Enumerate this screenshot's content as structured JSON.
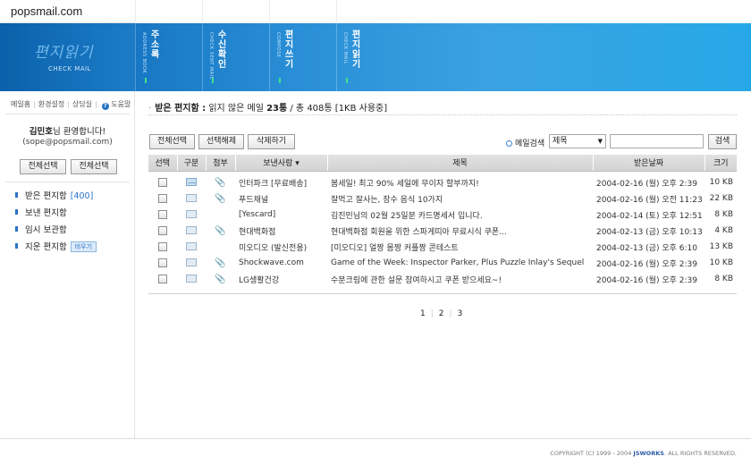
{
  "site": {
    "logo": "popsmail.com"
  },
  "banner": {
    "title": "편지읽기",
    "subtitle": "CHECK MAIL",
    "tabs": [
      {
        "ko": "주소록",
        "en": "ADDRESS BOOK"
      },
      {
        "ko": "수신확인",
        "en": "CHECK SENT MAIL"
      },
      {
        "ko": "편지쓰기",
        "en": "COMPOSE"
      },
      {
        "ko": "편지읽기",
        "en": "CHECK MAIL"
      }
    ]
  },
  "sidebar": {
    "links": [
      "메일홈",
      "환경설정",
      "상담실",
      "도움말"
    ],
    "welcome_name": "김민호",
    "welcome_suffix": "님 환영합니다!",
    "email": "(sope@popsmail.com)",
    "btn_a": "전체선택",
    "btn_b": "전체선택",
    "folders": [
      {
        "name": "받은 편지함",
        "count": "[400]"
      },
      {
        "name": "보낸 편지함"
      },
      {
        "name": "임시 보관함"
      },
      {
        "name": "지운 편지함",
        "action": "비우기"
      }
    ]
  },
  "main": {
    "title_prefix": "·",
    "title": "받은 편지함 :",
    "summary_a": " 읽지 않은 메일 ",
    "unread": "23통",
    "summary_b": " / 총 ",
    "total": "408통",
    "summary_c": " [1KB 사용중]",
    "actions": [
      "전체선택",
      "선택해제",
      "삭제하기"
    ],
    "search_label": "메일검색",
    "search_field": "제목",
    "search_button": "검색",
    "columns": [
      "선택",
      "구분",
      "첨부",
      "보낸사람 ▾",
      "제목",
      "받은날짜",
      "크기"
    ],
    "rows": [
      {
        "from": "인터파크 [무료배송]",
        "subject": "봄세일! 최고 90% 세일에 무이자 할부까지!",
        "date": "2004-02-16 (월) 오후 2:39",
        "size": "10 KB",
        "type": "closed",
        "attach": true
      },
      {
        "from": "푸드채널",
        "subject": "잘먹고 잘사는, 장수 음식 10가지",
        "date": "2004-02-16 (월) 오전 11:23",
        "size": "22 KB",
        "type": "open",
        "attach": true
      },
      {
        "from": "[Yescard]",
        "subject": "김진민님의 02월 25일분 카드명세서 입니다.",
        "date": "2004-02-14 (토) 오후 12:51",
        "size": "8 KB",
        "type": "open",
        "attach": false
      },
      {
        "from": "현대백화점",
        "subject": "현대백화점 회원을 위한 스파게띠아 무료시식 쿠폰...",
        "date": "2004-02-13 (금) 오후 10:13",
        "size": "4 KB",
        "type": "open",
        "attach": true
      },
      {
        "from": "미오디오 (발신전용)",
        "subject": "[미오디오] 얼짱 몸짱 커플짱 콘테스트",
        "date": "2004-02-13 (금) 오후 6:10",
        "size": "13 KB",
        "type": "open",
        "attach": false
      },
      {
        "from": "Shockwave.com",
        "subject": "Game of the Week: Inspector Parker, Plus Puzzle Inlay's Sequel",
        "date": "2004-02-16 (월) 오후 2:39",
        "size": "10 KB",
        "type": "open",
        "attach": true
      },
      {
        "from": "LG생활건강",
        "subject": "수분크림에 관한 설문 참여하시고 쿠폰 받으세요~!",
        "date": "2004-02-16 (월) 오후 2:39",
        "size": "8 KB",
        "type": "open",
        "attach": true
      }
    ],
    "pages": [
      "1",
      "2",
      "3"
    ]
  },
  "footer": {
    "copyright_a": "COPYRIGHT (C) 1999 - 2004 ",
    "brand": "JSWORKS",
    "copyright_b": ". ALL RIGHTS RESERVED."
  }
}
